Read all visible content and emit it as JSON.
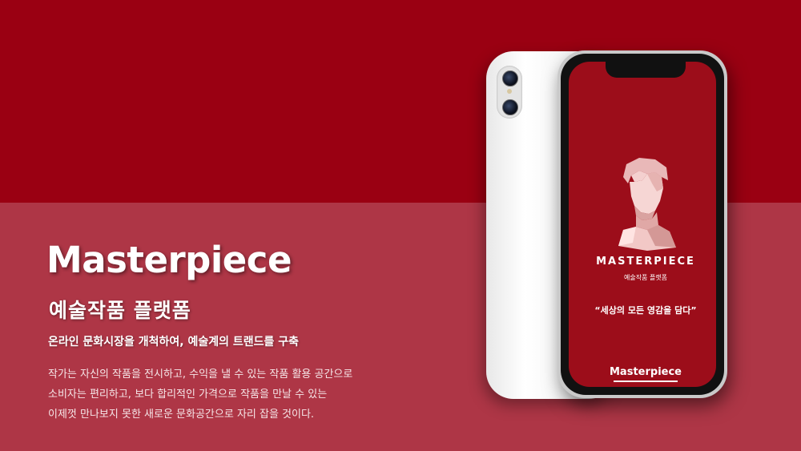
{
  "colors": {
    "top_band": "#9a0012",
    "bottom_band": "#ae3646",
    "screen": "#9c0d1a"
  },
  "hero": {
    "title": "Masterpiece",
    "subtitle": "예술작품 플랫폼",
    "tagline": "온라인 문화시장을 개척하여, 예술계의 트랜드를 구축",
    "description": [
      "작가는 자신의 작품을 전시하고, 수익을 낼 수 있는 작품 활용 공간으로",
      "소비자는 편리하고, 보다 합리적인 가격으로 작품을 만날 수 있는",
      "이제껏 만나보지 못한 새로운 문화공간으로 자리 잡을 것이다."
    ]
  },
  "app_screen": {
    "brand": "MASTERPIECE",
    "subbrand": "예술작품 플랫폼",
    "quote": "“세상의 모든 영감을 담다”",
    "logo": "Masterpiece"
  },
  "icons": {
    "bust": "david-bust-icon",
    "camera": "camera-lens-icon"
  }
}
